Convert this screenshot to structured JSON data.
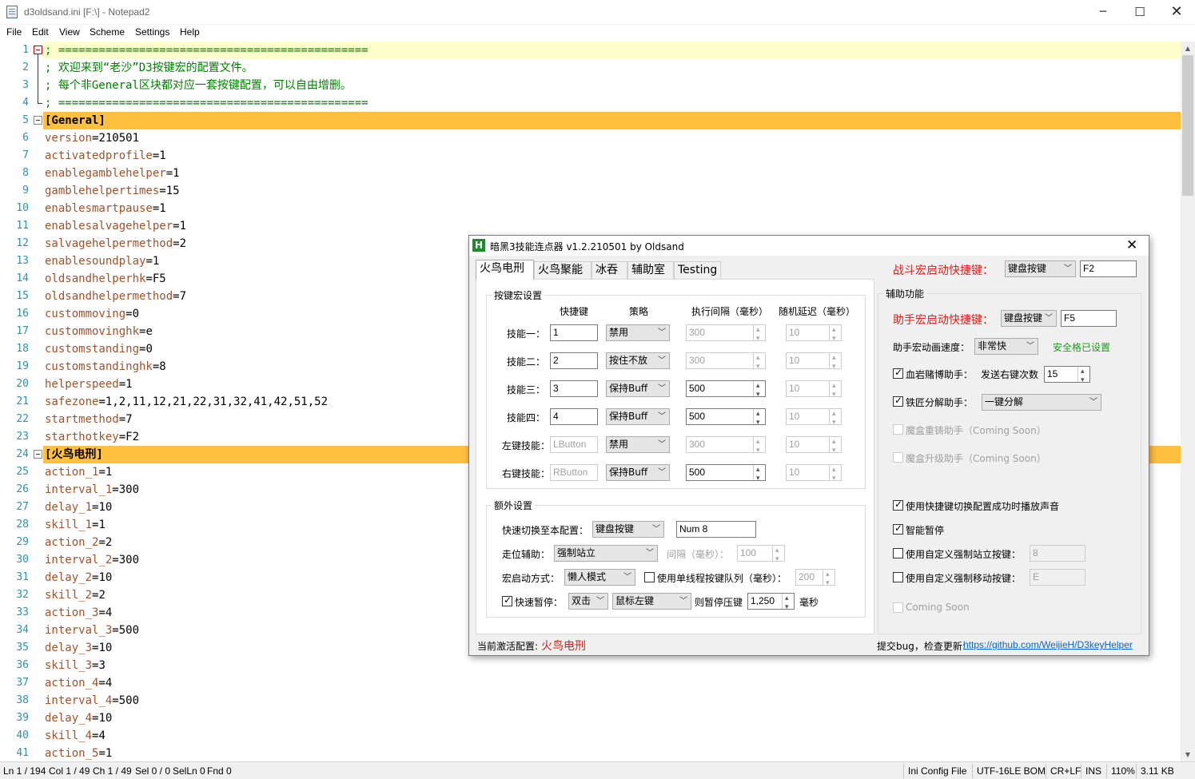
{
  "notepad": {
    "title": "d3oldsand.ini [F:\\] - Notepad2",
    "controls": {
      "minimize": "─",
      "maximize": "☐",
      "close": "✕"
    },
    "menu": [
      "File",
      "Edit",
      "View",
      "Scheme",
      "Settings",
      "Help"
    ],
    "lines": [
      {
        "n": "1",
        "t": "comment",
        "text": "; =============================================="
      },
      {
        "n": "2",
        "t": "comment",
        "text": "; 欢迎来到“老沙”D3按键宏的配置文件。"
      },
      {
        "n": "3",
        "t": "comment",
        "text": "; 每个非General区块都对应一套按键配置，可以自由增删。"
      },
      {
        "n": "4",
        "t": "comment",
        "text": "; =============================================="
      },
      {
        "n": "5",
        "t": "section",
        "text": "[General]"
      },
      {
        "n": "6",
        "t": "kv",
        "key": "version",
        "val": "210501"
      },
      {
        "n": "7",
        "t": "kv",
        "key": "activatedprofile",
        "val": "1"
      },
      {
        "n": "8",
        "t": "kv",
        "key": "enablegamblehelper",
        "val": "1"
      },
      {
        "n": "9",
        "t": "kv",
        "key": "gamblehelpertimes",
        "val": "15"
      },
      {
        "n": "10",
        "t": "kv",
        "key": "enablesmartpause",
        "val": "1"
      },
      {
        "n": "11",
        "t": "kv",
        "key": "enablesalvagehelper",
        "val": "1"
      },
      {
        "n": "12",
        "t": "kv",
        "key": "salvagehelpermethod",
        "val": "2"
      },
      {
        "n": "13",
        "t": "kv",
        "key": "enablesoundplay",
        "val": "1"
      },
      {
        "n": "14",
        "t": "kv",
        "key": "oldsandhelperhk",
        "val": "F5"
      },
      {
        "n": "15",
        "t": "kv",
        "key": "oldsandhelpermethod",
        "val": "7"
      },
      {
        "n": "16",
        "t": "kv",
        "key": "custommoving",
        "val": "0"
      },
      {
        "n": "17",
        "t": "kv",
        "key": "custommovinghk",
        "val": "e"
      },
      {
        "n": "18",
        "t": "kv",
        "key": "customstanding",
        "val": "0"
      },
      {
        "n": "19",
        "t": "kv",
        "key": "customstandinghk",
        "val": "8"
      },
      {
        "n": "20",
        "t": "kv",
        "key": "helperspeed",
        "val": "1"
      },
      {
        "n": "21",
        "t": "kv",
        "key": "safezone",
        "val": "1,2,11,12,21,22,31,32,41,42,51,52"
      },
      {
        "n": "22",
        "t": "kv",
        "key": "startmethod",
        "val": "7"
      },
      {
        "n": "23",
        "t": "kv",
        "key": "starthotkey",
        "val": "F2"
      },
      {
        "n": "24",
        "t": "section",
        "text": "[火鸟电刑]"
      },
      {
        "n": "25",
        "t": "kv",
        "key": "action_1",
        "val": "1"
      },
      {
        "n": "26",
        "t": "kv",
        "key": "interval_1",
        "val": "300"
      },
      {
        "n": "27",
        "t": "kv",
        "key": "delay_1",
        "val": "10"
      },
      {
        "n": "28",
        "t": "kv",
        "key": "skill_1",
        "val": "1"
      },
      {
        "n": "29",
        "t": "kv",
        "key": "action_2",
        "val": "2"
      },
      {
        "n": "30",
        "t": "kv",
        "key": "interval_2",
        "val": "300"
      },
      {
        "n": "31",
        "t": "kv",
        "key": "delay_2",
        "val": "10"
      },
      {
        "n": "32",
        "t": "kv",
        "key": "skill_2",
        "val": "2"
      },
      {
        "n": "33",
        "t": "kv",
        "key": "action_3",
        "val": "4"
      },
      {
        "n": "34",
        "t": "kv",
        "key": "interval_3",
        "val": "500"
      },
      {
        "n": "35",
        "t": "kv",
        "key": "delay_3",
        "val": "10"
      },
      {
        "n": "36",
        "t": "kv",
        "key": "skill_3",
        "val": "3"
      },
      {
        "n": "37",
        "t": "kv",
        "key": "action_4",
        "val": "4"
      },
      {
        "n": "38",
        "t": "kv",
        "key": "interval_4",
        "val": "500"
      },
      {
        "n": "39",
        "t": "kv",
        "key": "delay_4",
        "val": "10"
      },
      {
        "n": "40",
        "t": "kv",
        "key": "skill_4",
        "val": "4"
      },
      {
        "n": "41",
        "t": "kv",
        "key": "action_5",
        "val": "1"
      }
    ],
    "status": [
      "Ln 1 / 194",
      "Col 1 / 49",
      "Ch 1 / 49",
      "Sel 0 / 0",
      "SelLn 0",
      "Fnd 0",
      "Ini Config File",
      "UTF-16LE BOM",
      "CR+LF",
      "INS",
      "110%",
      "3.11 KB"
    ]
  },
  "dialog": {
    "icon_text": "H",
    "title": "暗黑3技能连点器 v1.2.210501   by Oldsand",
    "close": "✕",
    "tabs": [
      "火鸟电刑",
      "火鸟聚能",
      "冰吞",
      "辅助室",
      "Testing"
    ],
    "active_tab": 0,
    "battle_hotkey": {
      "label": "战斗宏启动快捷键：",
      "type": "键盘按键",
      "key": "F2"
    },
    "keymacro": {
      "title": "按键宏设置",
      "headers": [
        "快捷键",
        "策略",
        "执行间隔（毫秒）",
        "随机延迟（毫秒）"
      ],
      "rows": [
        {
          "label": "技能一：",
          "key": "1",
          "strategy": "禁用",
          "interval": "300",
          "delay": "10",
          "key_enabled": true,
          "interval_enabled": false
        },
        {
          "label": "技能二：",
          "key": "2",
          "strategy": "按住不放",
          "interval": "300",
          "delay": "10",
          "key_enabled": true,
          "interval_enabled": false
        },
        {
          "label": "技能三：",
          "key": "3",
          "strategy": "保持Buff",
          "interval": "500",
          "delay": "10",
          "key_enabled": true,
          "interval_enabled": true
        },
        {
          "label": "技能四：",
          "key": "4",
          "strategy": "保持Buff",
          "interval": "500",
          "delay": "10",
          "key_enabled": true,
          "interval_enabled": true
        },
        {
          "label": "左键技能：",
          "key": "LButton",
          "strategy": "禁用",
          "interval": "300",
          "delay": "10",
          "key_enabled": false,
          "interval_enabled": false
        },
        {
          "label": "右键技能：",
          "key": "RButton",
          "strategy": "保持Buff",
          "interval": "500",
          "delay": "10",
          "key_enabled": false,
          "interval_enabled": true
        }
      ]
    },
    "extra": {
      "title": "额外设置",
      "switch_label": "快速切换至本配置：",
      "switch_type": "键盘按键",
      "switch_key": "Num 8",
      "move_label": "走位辅助：",
      "move_value": "强制站立",
      "interval_label": "间隔（毫秒）：",
      "interval_value": "100",
      "start_label": "宏启动方式：",
      "start_value": "懒人模式",
      "single_thread_label": "使用单线程按键队列（毫秒）：",
      "single_thread_value": "200",
      "quick_pause_label": "快速暂停：",
      "quick_pause_mode": "双击",
      "quick_pause_button": "鼠标左键",
      "then_pause_label": "则暂停压键",
      "pause_ms": "1,250",
      "ms_label": "毫秒"
    },
    "helper": {
      "title": "辅助功能",
      "hotkey_label": "助手宏启动快捷键：",
      "hotkey_type": "键盘按键",
      "hotkey_key": "F5",
      "speed_label": "助手宏动画速度：",
      "speed_value": "非常快",
      "safe_label": "安全格已设置",
      "gamble_label": "血岩赌博助手：",
      "gamble_times_label": "发送右键次数",
      "gamble_times": "15",
      "salvage_label": "铁匠分解助手：",
      "salvage_value": "一键分解",
      "reforge_label": "魔盒重铸助手（Coming Soon）",
      "upgrade_label": "魔盒升级助手（Coming Soon）",
      "sound_label": "使用快捷键切换配置成功时播放声音",
      "smart_pause_label": "智能暂停",
      "custom_stand_label": "使用自定义强制站立按键：",
      "custom_stand_key": "8",
      "custom_move_label": "使用自定义强制移动按键：",
      "custom_move_key": "E",
      "coming_soon_label": "Coming Soon"
    },
    "footer": {
      "current_label": "当前激活配置:",
      "current_value": "火鸟电刑",
      "bug_label": "提交bug，检查更新:",
      "link": "https://github.com/WeijieH/D3keyHelper"
    }
  }
}
